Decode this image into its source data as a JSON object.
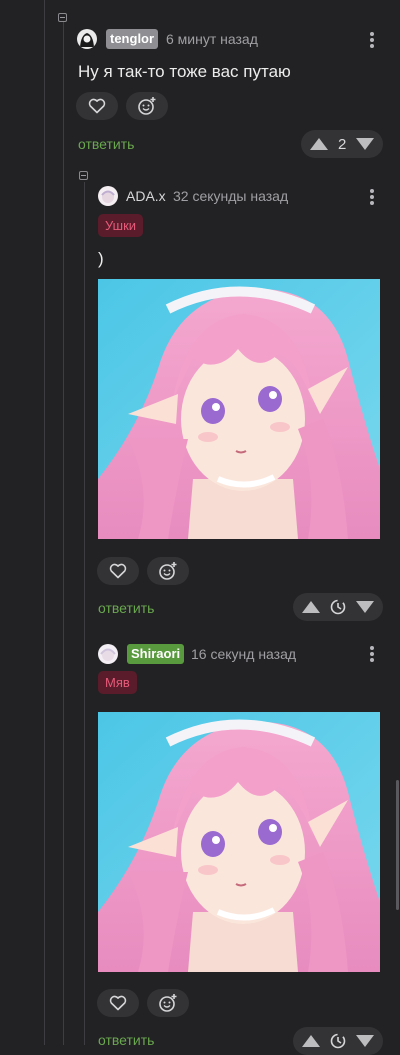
{
  "colors": {
    "background": "#222224",
    "reply_link": "#6aa84f",
    "tag_bg": "#5a1c2a",
    "tag_text": "#e65a7a",
    "user_badge_gray": "#8e8e93",
    "user_badge_green": "#5a9a3e"
  },
  "comments": [
    {
      "username": "tenglor",
      "time": "6 минут назад",
      "text": "Ну я так-то тоже вас путаю",
      "reply_label": "ответить",
      "score": "2"
    },
    {
      "username": "ADA.x",
      "time": "32 секунды назад",
      "tag": "Ушки",
      "text": ")",
      "image_alt": "anime-girl-pink-hair",
      "reply_label": "ответить"
    },
    {
      "username": "Shiraori",
      "time": "16 секунд назад",
      "tag": "Мяв",
      "image_alt": "anime-girl-pink-hair",
      "reply_label": "ответить"
    }
  ],
  "icons": {
    "like": "heart-icon",
    "react": "emoji-add-icon",
    "more": "more-vertical-icon",
    "upvote": "arrow-up-icon",
    "downvote": "arrow-down-icon",
    "pending": "clock-icon"
  }
}
